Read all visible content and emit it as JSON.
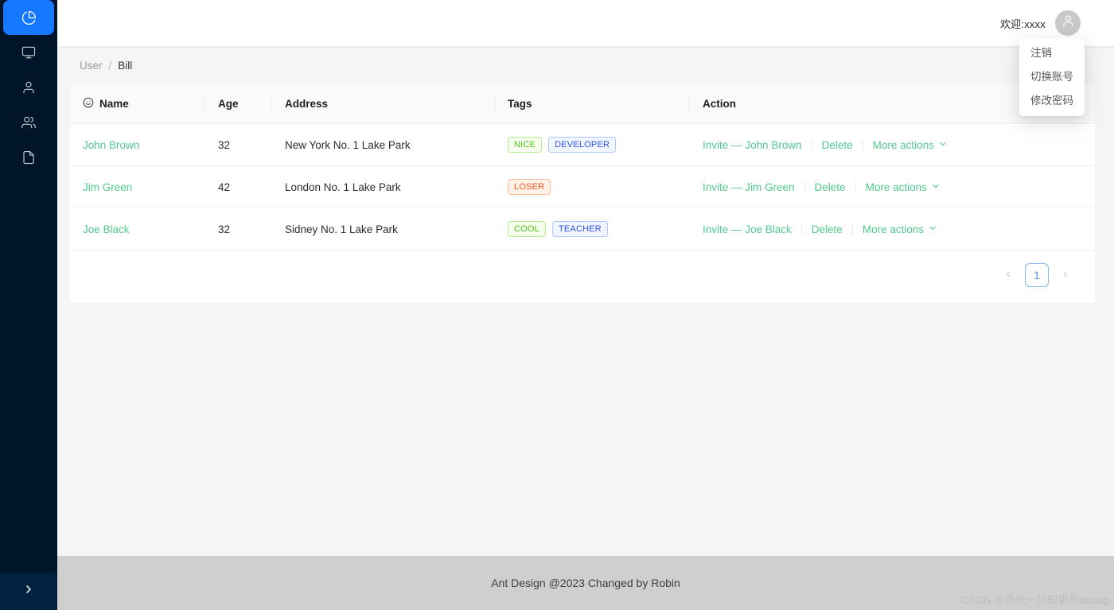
{
  "sidebar": {
    "items": [
      {
        "icon": "pie-chart-icon",
        "name": "sidebar-item-dashboard",
        "active": true
      },
      {
        "icon": "desktop-icon",
        "name": "sidebar-item-monitor",
        "active": false
      },
      {
        "icon": "user-icon",
        "name": "sidebar-item-user",
        "active": false
      },
      {
        "icon": "team-icon",
        "name": "sidebar-item-team",
        "active": false
      },
      {
        "icon": "file-icon",
        "name": "sidebar-item-file",
        "active": false
      }
    ],
    "trigger_icon": "chevron-right-icon"
  },
  "topbar": {
    "welcome": "欢迎:xxxx",
    "avatar_icon": "user-avatar-icon",
    "dropdown": {
      "items": [
        {
          "label": "注销"
        },
        {
          "label": "切换账号"
        },
        {
          "label": "修改密码"
        }
      ]
    }
  },
  "breadcrumb": {
    "parent": "User",
    "separator": "/",
    "current": "Bill"
  },
  "table": {
    "columns": [
      {
        "key": "name",
        "label": "Name",
        "icon": "smile-icon"
      },
      {
        "key": "age",
        "label": "Age",
        "icon": null
      },
      {
        "key": "address",
        "label": "Address",
        "icon": null
      },
      {
        "key": "tags",
        "label": "Tags",
        "icon": null
      },
      {
        "key": "action",
        "label": "Action",
        "icon": null
      }
    ],
    "rows": [
      {
        "name": "John Brown",
        "age": "32",
        "address": "New York No. 1 Lake Park",
        "tags": [
          {
            "text": "NICE",
            "color": "green"
          },
          {
            "text": "DEVELOPER",
            "color": "geekblue"
          }
        ],
        "invite": "Invite — John Brown",
        "delete": "Delete",
        "more": "More actions"
      },
      {
        "name": "Jim Green",
        "age": "42",
        "address": "London No. 1 Lake Park",
        "tags": [
          {
            "text": "LOSER",
            "color": "volcano"
          }
        ],
        "invite": "Invite — Jim Green",
        "delete": "Delete",
        "more": "More actions"
      },
      {
        "name": "Joe Black",
        "age": "32",
        "address": "Sidney No. 1 Lake Park",
        "tags": [
          {
            "text": "COOL",
            "color": "green"
          },
          {
            "text": "TEACHER",
            "color": "geekblue"
          }
        ],
        "invite": "Invite — Joe Black",
        "delete": "Delete",
        "more": "More actions"
      }
    ]
  },
  "pagination": {
    "prev_icon": "chevron-left-icon",
    "next_icon": "chevron-right-icon",
    "current_page": "1"
  },
  "footer": {
    "text": "Ant Design @2023 Changed by Robin",
    "watermark": "CSDN @杀死一只知更鸟debug"
  },
  "colors": {
    "sidebar_bg": "#001529",
    "accent_blue": "#1677ff",
    "link_green": "#52c98f",
    "tag_green": "#52c41a",
    "tag_geekblue": "#2f54eb",
    "tag_volcano": "#fa541c",
    "footer_bg": "#cfcfcf",
    "page_bg": "#f5f5f5"
  }
}
